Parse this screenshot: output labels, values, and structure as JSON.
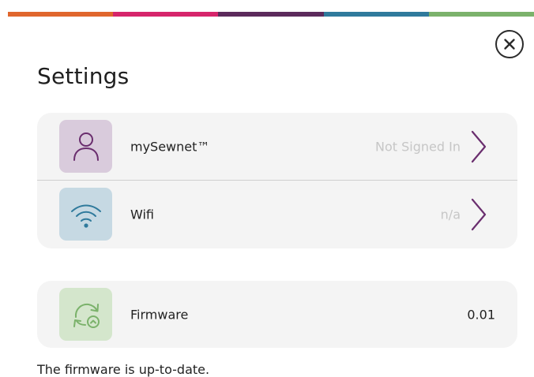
{
  "colors": {
    "stripe": [
      "#e0662d",
      "#d6256b",
      "#5c2a5c",
      "#2f7a9c",
      "#7bb26b"
    ],
    "account_tile": "#d9cbdc",
    "wifi_tile": "#c6d9e3",
    "firmware_tile": "#d4e6cc",
    "chevron": "#6a2e6e",
    "account_icon": "#6a2e6e",
    "wifi_icon": "#2f7a9c",
    "firmware_icon": "#7bb26b"
  },
  "header": {
    "title": "Settings",
    "close_icon": "close-icon"
  },
  "rows": [
    {
      "label": "mySewnet™",
      "status": "Not Signed In",
      "icon": "user-icon"
    },
    {
      "label": "Wifi",
      "status": "n/a",
      "icon": "wifi-icon"
    }
  ],
  "firmware": {
    "label": "Firmware",
    "value": "0.01",
    "icon": "firmware-update-icon"
  },
  "footer": {
    "note": "The firmware is up-to-date."
  }
}
